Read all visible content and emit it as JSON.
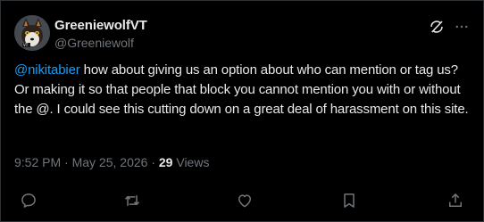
{
  "user": {
    "display_name": "GreeniewolfVT",
    "handle": "@Greeniewolf"
  },
  "header_icons": [
    "grok-icon",
    "more-icon"
  ],
  "tweet": {
    "mention": "@nikitabier",
    "text": " how about giving us an option about who can mention or tag us? Or making it so that people that block you cannot mention you with or without the @. I could see this cutting down on a great deal of harassment on this site."
  },
  "meta": {
    "time": "9:52 PM",
    "separator": " · ",
    "date": "May 25, 2026",
    "views_count": "29",
    "views_label": "Views"
  },
  "action_icons": [
    "reply-icon",
    "retweet-icon",
    "like-icon",
    "bookmark-icon",
    "share-icon"
  ],
  "colors": {
    "background": "#000000",
    "text": "#e7e9ea",
    "muted": "#71767b",
    "accent": "#1d9bf0",
    "border": "#2f3336"
  }
}
